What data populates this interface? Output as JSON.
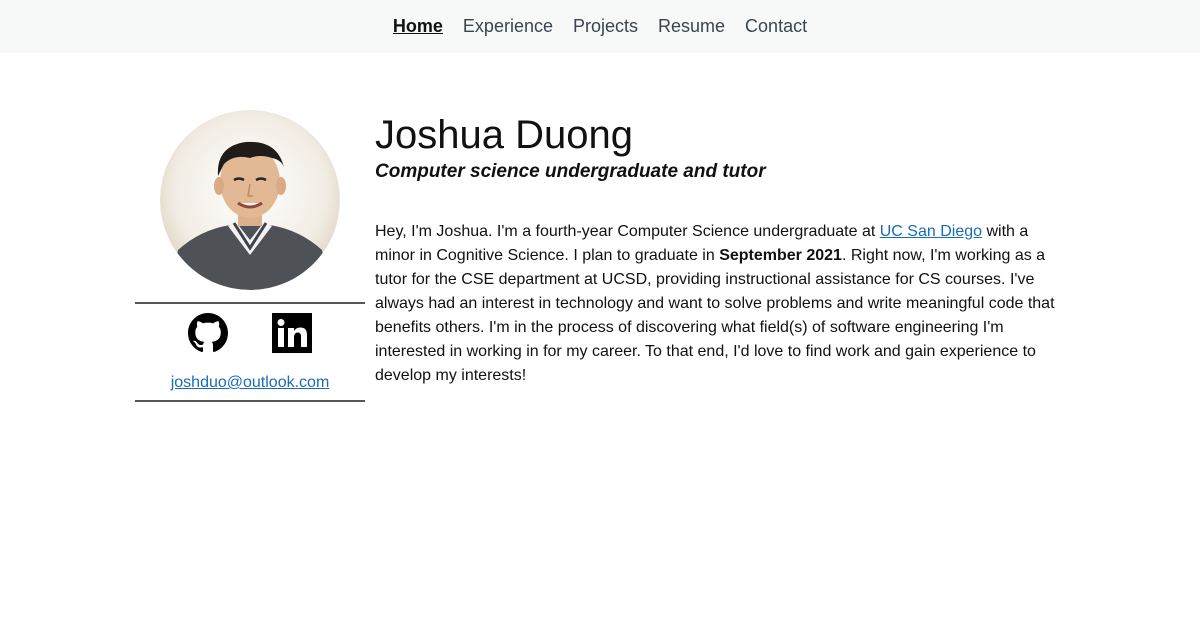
{
  "nav": {
    "items": [
      {
        "label": "Home",
        "active": true
      },
      {
        "label": "Experience",
        "active": false
      },
      {
        "label": "Projects",
        "active": false
      },
      {
        "label": "Resume",
        "active": false
      },
      {
        "label": "Contact",
        "active": false
      }
    ]
  },
  "profile": {
    "email": "joshduo@outlook.com",
    "social": [
      "github-icon",
      "linkedin-icon"
    ]
  },
  "header": {
    "name": "Joshua Duong",
    "tagline": "Computer science undergraduate and tutor"
  },
  "bio": {
    "part1": "Hey, I'm Joshua. I'm a fourth-year Computer Science undergraduate at ",
    "link": "UC San Diego",
    "part2": " with a minor in Cognitive Science. I plan to graduate in ",
    "grad": "September 2021",
    "part3": ". Right now, I'm working as a tutor for the CSE department at UCSD, providing instructional assistance for CS courses. I've always had an interest in technology and want to solve problems and write meaningful code that benefits others. I'm in the process of discovering what field(s) of software engineering I'm interested in working in for my career. To that end, I'd love to find work and gain experience to develop my interests!"
  },
  "colors": {
    "nav_bg": "#f7f8f8",
    "link": "#1a6bb8",
    "text": "#111111"
  }
}
